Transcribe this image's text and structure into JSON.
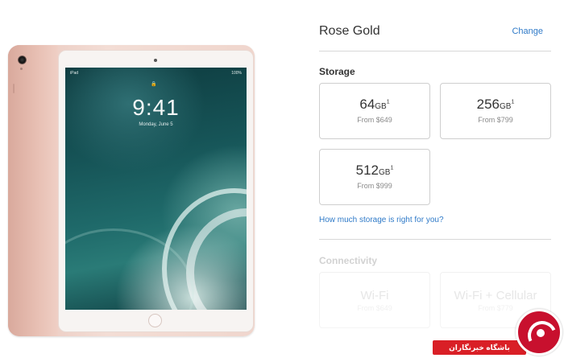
{
  "product": {
    "color_name": "Rose Gold",
    "change_label": "Change",
    "image": {
      "lock_time": "9:41",
      "lock_date": "Monday, June 5",
      "status_carrier": "iPad",
      "status_battery": "100%"
    }
  },
  "storage": {
    "title": "Storage",
    "options": [
      {
        "capacity": "64",
        "unit": "GB",
        "footnote": "1",
        "price": "From $649"
      },
      {
        "capacity": "256",
        "unit": "GB",
        "footnote": "1",
        "price": "From $799"
      },
      {
        "capacity": "512",
        "unit": "GB",
        "footnote": "1",
        "price": "From $999"
      }
    ],
    "help_link": "How much storage is right for you?"
  },
  "connectivity": {
    "title": "Connectivity",
    "options": [
      {
        "label": "Wi-Fi",
        "price": "From $649"
      },
      {
        "label": "Wi-Fi + Cellular",
        "price": "From $779"
      }
    ]
  },
  "watermark": {
    "text": "باشگاه خبرنگاران",
    "bar_color": "#d91f26"
  },
  "colors": {
    "accent_link": "#2f7ac8",
    "rose_gold": "#eac9bf"
  }
}
